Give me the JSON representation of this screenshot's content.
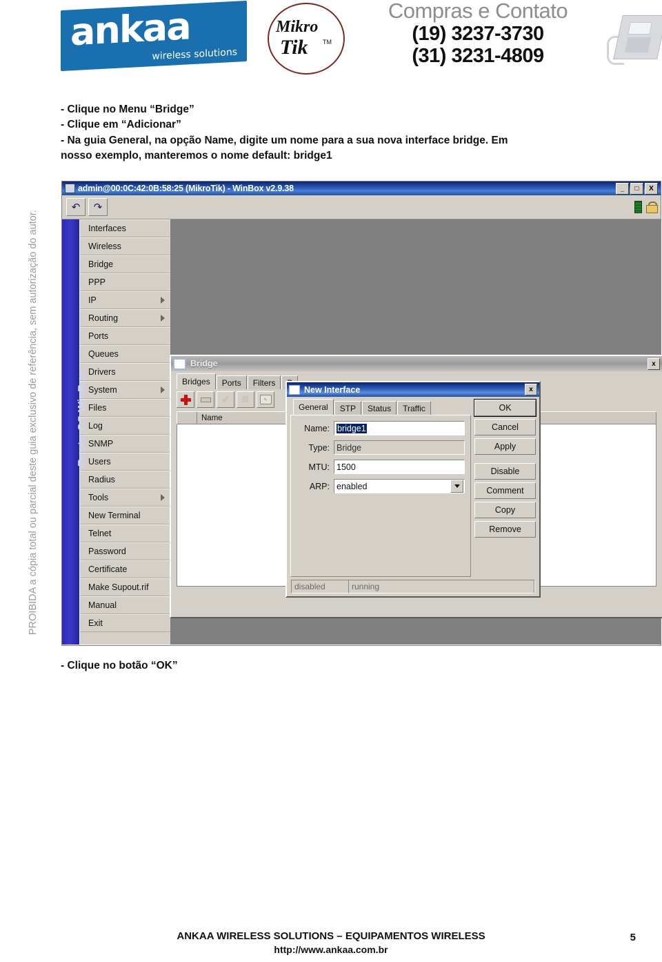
{
  "brand": {
    "logo_word": "ankaa",
    "logo_tagline": "wireless solutions",
    "partner_line1": "Mikro",
    "partner_line2": "Tik",
    "partner_tm": "TM",
    "contact_title": "Compras e Contato",
    "phone1": "(19) 3237-3730",
    "phone2": "(31) 3231-4809"
  },
  "watermark": "PROIBIDA a cópia total ou parcial deste guia exclusivo de referência, sem autorização do autor.",
  "intro": {
    "line1": "- Clique no Menu “Bridge”",
    "line2": "- Clique em “Adicionar”",
    "line3": "- Na guia General, na opção Name, digite um nome para a sua nova interface bridge. Em",
    "line4": "nosso exemplo, manteremos o nome default: bridge1"
  },
  "winbox": {
    "title": "admin@00:0C:42:0B:58:25 (MikroTik) - WinBox v2.9.38",
    "min_label": "_",
    "max_label": "□",
    "close_label": "X",
    "toolbar": {
      "undo_label": "↶",
      "redo_label": "↷"
    },
    "strip_label": "RouterOS WinBox",
    "menu": [
      {
        "label": "Interfaces",
        "submenu": false
      },
      {
        "label": "Wireless",
        "submenu": false
      },
      {
        "label": "Bridge",
        "submenu": false
      },
      {
        "label": "PPP",
        "submenu": false
      },
      {
        "label": "IP",
        "submenu": true
      },
      {
        "label": "Routing",
        "submenu": true
      },
      {
        "label": "Ports",
        "submenu": false
      },
      {
        "label": "Queues",
        "submenu": false
      },
      {
        "label": "Drivers",
        "submenu": false
      },
      {
        "label": "System",
        "submenu": true
      },
      {
        "label": "Files",
        "submenu": false
      },
      {
        "label": "Log",
        "submenu": false
      },
      {
        "label": "SNMP",
        "submenu": false
      },
      {
        "label": "Users",
        "submenu": false
      },
      {
        "label": "Radius",
        "submenu": false
      },
      {
        "label": "Tools",
        "submenu": true
      },
      {
        "label": "New Terminal",
        "submenu": false
      },
      {
        "label": "Telnet",
        "submenu": false
      },
      {
        "label": "Password",
        "submenu": false
      },
      {
        "label": "Certificate",
        "submenu": false
      },
      {
        "label": "Make Supout.rif",
        "submenu": false
      },
      {
        "label": "Manual",
        "submenu": false
      },
      {
        "label": "Exit",
        "submenu": false
      }
    ]
  },
  "bridge_window": {
    "title": "Bridge",
    "close_label": "x",
    "tabs": [
      "Bridges",
      "Ports",
      "Filters",
      "B"
    ],
    "active_tab": "Bridges",
    "toolbar_icons": [
      "add-icon",
      "remove-icon",
      "enable-icon",
      "disable-icon",
      "comment-icon"
    ],
    "column_header": "Name"
  },
  "new_interface": {
    "title": "New Interface",
    "close_label": "x",
    "tabs": [
      "General",
      "STP",
      "Status",
      "Traffic"
    ],
    "active_tab": "General",
    "fields": [
      {
        "label": "Name:",
        "value": "bridge1",
        "kind": "text-selected"
      },
      {
        "label": "Type:",
        "value": "Bridge",
        "kind": "readonly"
      },
      {
        "label": "MTU:",
        "value": "1500",
        "kind": "text"
      },
      {
        "label": "ARP:",
        "value": "enabled",
        "kind": "combo"
      }
    ],
    "buttons": [
      "OK",
      "Cancel",
      "Apply",
      "Disable",
      "Comment",
      "Copy",
      "Remove"
    ],
    "status": [
      "disabled",
      "running"
    ]
  },
  "note": "- Clique no botão “OK”",
  "footer": {
    "line1": "ANKAA WIRELESS SOLUTIONS – EQUIPAMENTOS WIRELESS",
    "line2": "http://www.ankaa.com.br",
    "page": "5"
  }
}
